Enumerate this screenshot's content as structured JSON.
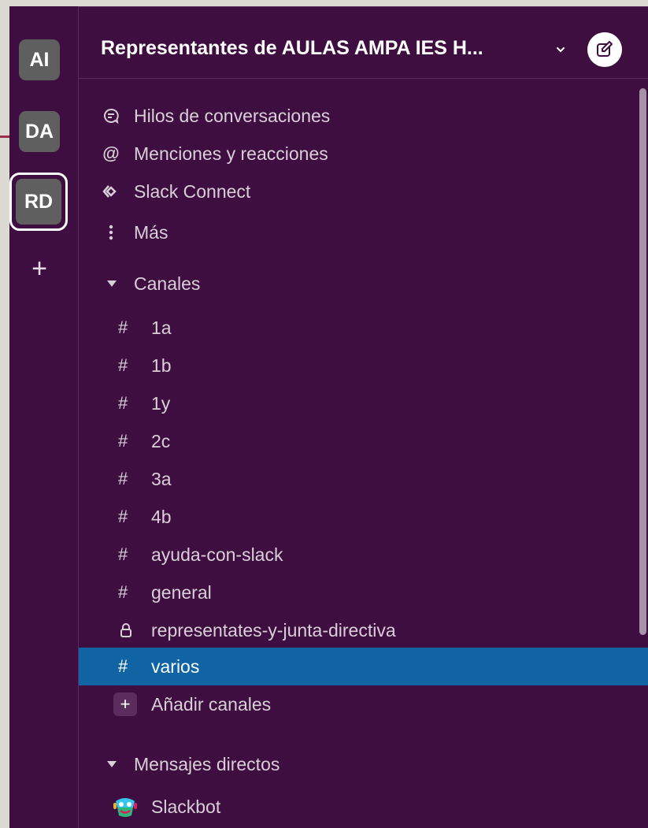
{
  "workspaces": [
    {
      "initials": "AI",
      "active": false
    },
    {
      "initials": "DA",
      "active": false
    },
    {
      "initials": "RD",
      "active": true
    }
  ],
  "add_workspace_label": "+",
  "header": {
    "team_name": "Representantes de AULAS AMPA IES H..."
  },
  "nav": [
    {
      "label": "Hilos de conversaciones",
      "icon": "threads-icon"
    },
    {
      "label": "Menciones y reacciones",
      "icon": "at-mention-icon"
    },
    {
      "label": "Slack Connect",
      "icon": "slack-connect-icon"
    },
    {
      "label": "Más",
      "icon": "more-vertical-icon"
    }
  ],
  "channels_section": {
    "label": "Canales",
    "channels": [
      {
        "name": "1a",
        "type": "public"
      },
      {
        "name": "1b",
        "type": "public"
      },
      {
        "name": "1y",
        "type": "public"
      },
      {
        "name": "2c",
        "type": "public"
      },
      {
        "name": "3a",
        "type": "public"
      },
      {
        "name": "4b",
        "type": "public"
      },
      {
        "name": "ayuda-con-slack",
        "type": "public"
      },
      {
        "name": "general",
        "type": "public"
      },
      {
        "name": "representates-y-junta-directiva",
        "type": "private"
      },
      {
        "name": "varios",
        "type": "public",
        "selected": true
      }
    ],
    "add_label": "Añadir canales"
  },
  "dm_section": {
    "label": "Mensajes directos",
    "items": [
      {
        "name": "Slackbot"
      }
    ]
  },
  "colors": {
    "sidebar_bg": "#3f0e40",
    "selected_bg": "#1164a3",
    "text": "#d9cfd9"
  }
}
